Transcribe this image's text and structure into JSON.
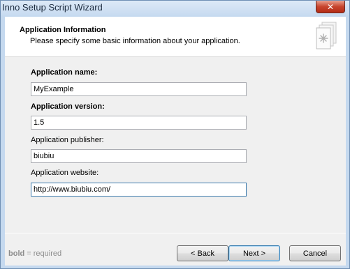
{
  "window": {
    "title": "Inno Setup Script Wizard",
    "close_glyph": "✕"
  },
  "header": {
    "title": "Application Information",
    "subtitle": "Please specify some basic information about your application.",
    "icon": "document-gear-icon"
  },
  "form": {
    "fields": [
      {
        "label": "Application name:",
        "value": "MyExample",
        "required": true
      },
      {
        "label": "Application version:",
        "value": "1.5",
        "required": true
      },
      {
        "label": "Application publisher:",
        "value": "biubiu",
        "required": false
      },
      {
        "label": "Application website:",
        "value": "http://www.biubiu.com/",
        "required": false
      }
    ]
  },
  "footer": {
    "hint_bold": "bold",
    "hint_rest": " = required",
    "back_label": "< Back",
    "next_label": "Next >",
    "cancel_label": "Cancel"
  },
  "colors": {
    "accent": "#3c7fb1",
    "frame": "#c5d9ef",
    "close": "#c7452e"
  }
}
